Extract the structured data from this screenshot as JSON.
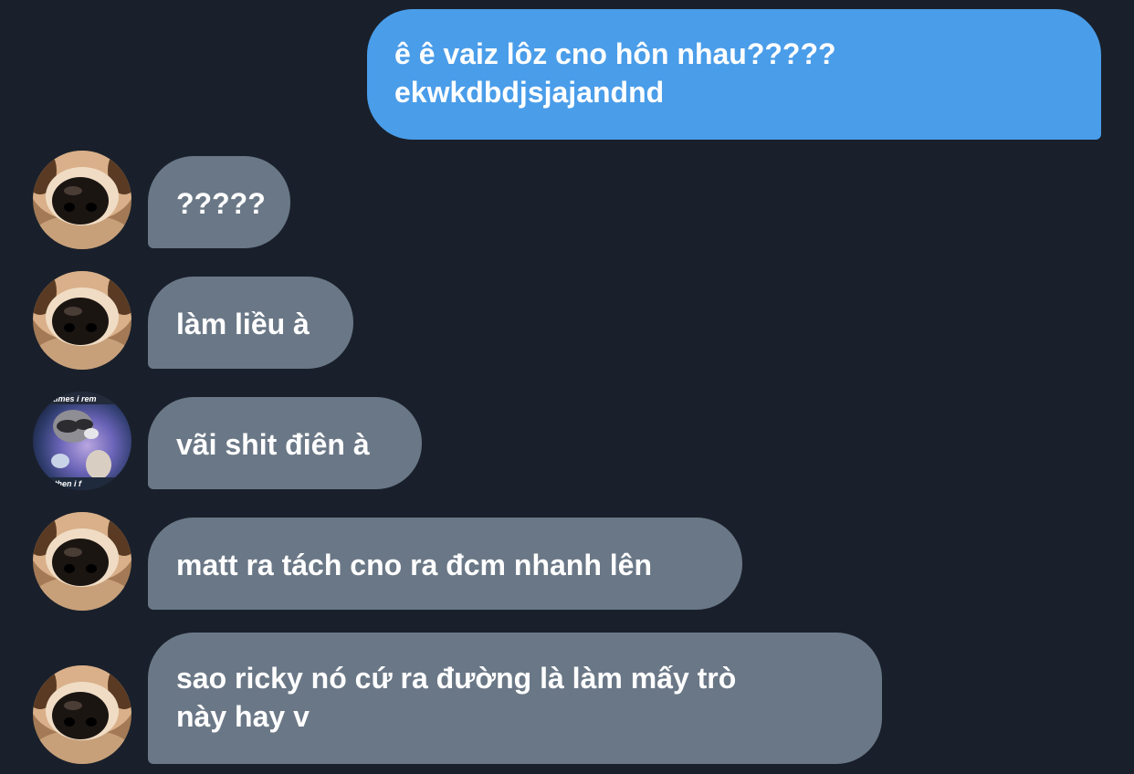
{
  "messages": [
    {
      "side": "outgoing",
      "lines": [
        "ê ê vaiz lôz cno hôn nhau?????",
        "ekwkdbdjsjajandnd"
      ]
    },
    {
      "side": "incoming",
      "avatar": "dog-nose-avatar",
      "lines": [
        "?????"
      ]
    },
    {
      "side": "incoming",
      "avatar": "dog-nose-avatar",
      "lines": [
        "làm liều à"
      ]
    },
    {
      "side": "incoming",
      "avatar": "raccoon-meme-avatar",
      "avatar_caption_top": "times i rem",
      "avatar_caption_bottom": "t then i f",
      "lines": [
        "vãi shit điên à"
      ]
    },
    {
      "side": "incoming",
      "avatar": "dog-nose-avatar",
      "lines": [
        "matt ra tách cno ra đcm nhanh lên"
      ]
    },
    {
      "side": "incoming",
      "avatar": "dog-nose-avatar",
      "lines": [
        "sao ricky nó cứ ra đường là làm mấy trò",
        "này hay v"
      ]
    }
  ],
  "colors": {
    "background": "#19202b",
    "outgoing_bubble": "#4a9de9",
    "incoming_bubble": "#6a7786",
    "text": "#ffffff"
  }
}
